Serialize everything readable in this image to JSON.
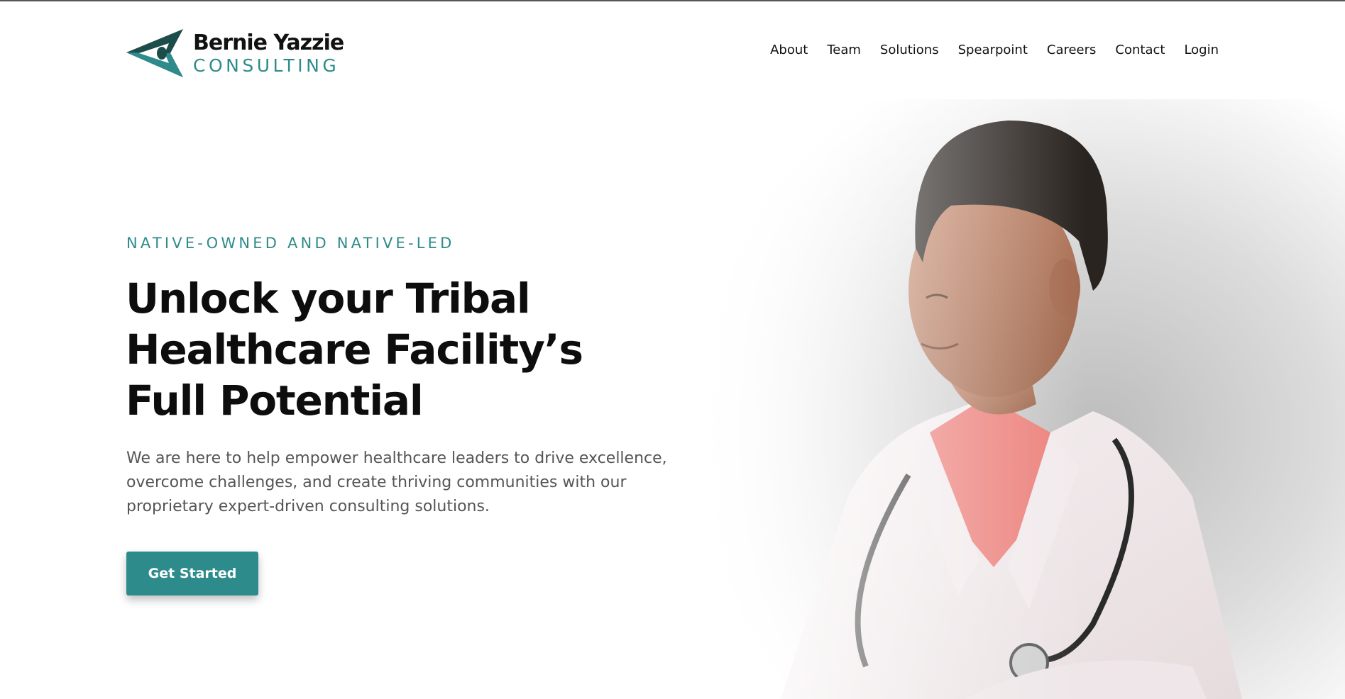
{
  "brand": {
    "name": "Bernie Yazzie",
    "subtitle": "CONSULTING",
    "accent_color": "#2e8b8b",
    "dark_accent_color": "#1d4d4a"
  },
  "nav": {
    "items": [
      {
        "label": "About"
      },
      {
        "label": "Team"
      },
      {
        "label": "Solutions"
      },
      {
        "label": "Spearpoint"
      },
      {
        "label": "Careers"
      },
      {
        "label": "Contact"
      },
      {
        "label": "Login"
      }
    ]
  },
  "hero": {
    "eyebrow": "NATIVE-OWNED AND NATIVE-LED",
    "headline_lines": [
      "Unlock your Tribal",
      "Healthcare Facility’s",
      "Full Potential"
    ],
    "description_lines": [
      "We are here to help empower healthcare leaders to drive excellence,",
      "overcome challenges, and create thriving communities with our",
      "proprietary expert-driven consulting solutions."
    ],
    "cta_label": "Get Started",
    "image_icon": "doctor-portrait-image"
  }
}
